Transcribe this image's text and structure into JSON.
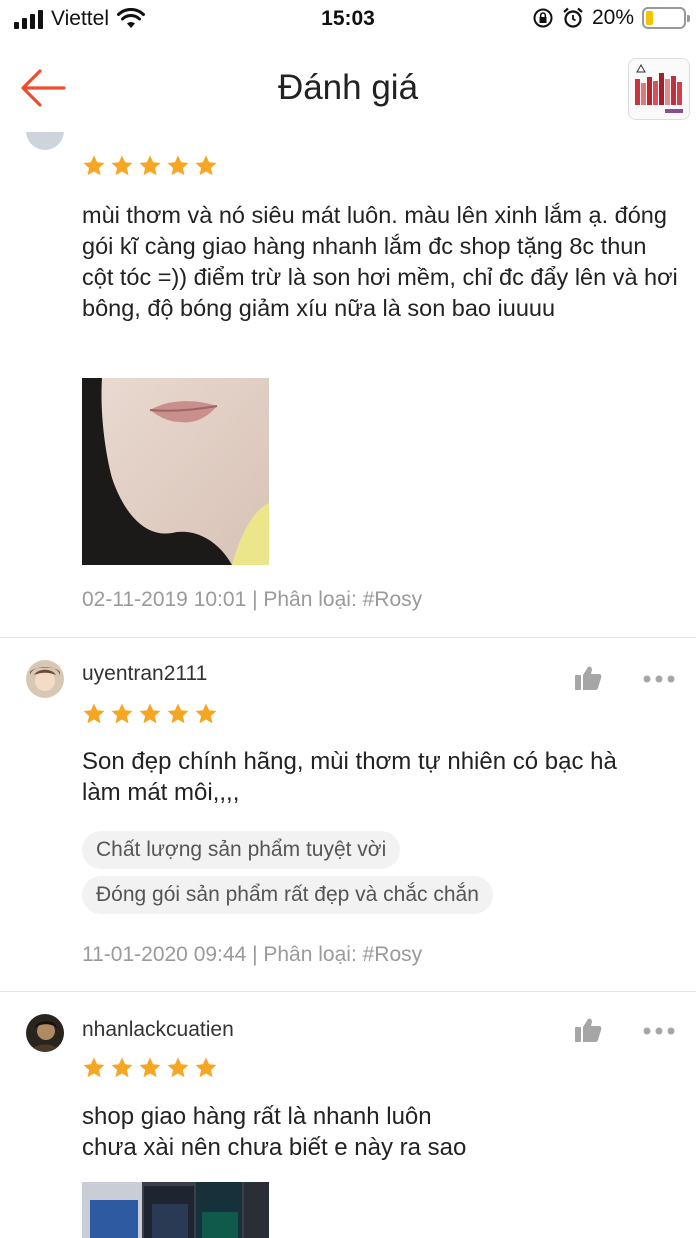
{
  "status_bar": {
    "carrier": "Viettel",
    "time": "15:03",
    "battery_percent": "20%",
    "battery_level": 0.2
  },
  "header": {
    "title": "Đánh giá",
    "back_icon": "arrow-left-icon",
    "accent_color": "#ee4d2d"
  },
  "reviews": [
    {
      "rating": 5,
      "text": "mùi thơm và nó siêu mát luôn. màu lên xinh lắm ạ. đóng gói kĩ càng giao hàng nhanh lắm đc shop tặng 8c thun cột tóc =)) điểm trừ là son hơi mềm, chỉ đc đẩy lên và hơi bông, độ bóng giảm xíu nữa là son bao iuuuu",
      "meta": "02-11-2019 10:01 | Phân loại: #Rosy"
    },
    {
      "username": "uyentran2111",
      "rating": 5,
      "text": "Son đẹp chính hãng, mùi thơm tự nhiên có bạc hà làm mát môi,,,,",
      "tags": [
        "Chất lượng sản phẩm tuyệt vời",
        "Đóng gói sản phẩm rất đẹp và chắc chắn"
      ],
      "meta": "11-01-2020 09:44 | Phân loại: #Rosy"
    },
    {
      "username": "nhanlackcuatien",
      "rating": 5,
      "text": "shop giao hàng rất là nhanh luôn\nchưa xài nên chưa biết e này ra sao"
    }
  ],
  "colors": {
    "star": "#f5a623",
    "muted_text": "#9a9a9a",
    "tag_bg": "#f2f2f2"
  }
}
